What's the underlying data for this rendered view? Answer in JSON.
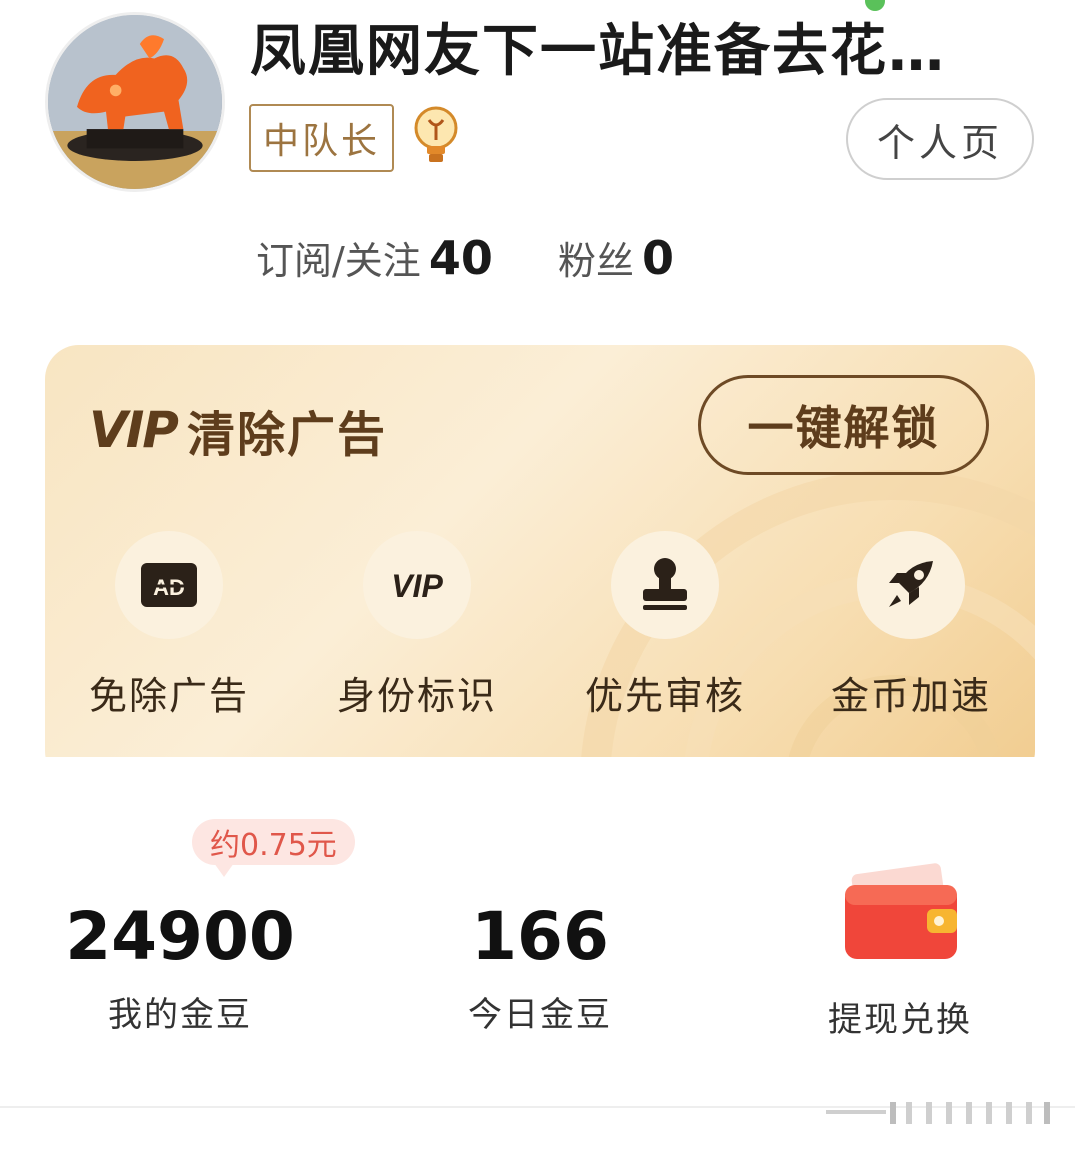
{
  "profile": {
    "username": "凤凰网友下一站准备去花…",
    "rank_badge": "中队长",
    "profile_button": "个人页",
    "following_label": "订阅/关注",
    "following_count": "40",
    "fans_label": "粉丝",
    "fans_count": "0"
  },
  "vip": {
    "logo": "VIP",
    "title": "清除广告",
    "unlock_button": "一键解锁",
    "perks": [
      {
        "label": "免除广告",
        "icon": "ad-block-icon"
      },
      {
        "label": "身份标识",
        "icon": "vip-badge-icon"
      },
      {
        "label": "优先审核",
        "icon": "stamp-icon"
      },
      {
        "label": "金币加速",
        "icon": "rocket-icon"
      }
    ]
  },
  "coins": {
    "price_tip": "约0.75元",
    "my_beans_value": "24900",
    "my_beans_label": "我的金豆",
    "today_beans_value": "166",
    "today_beans_label": "今日金豆",
    "withdraw_label": "提现兑换"
  },
  "colors": {
    "vip_brown": "#5e3d1c",
    "badge_gold": "#9c7440",
    "tip_red": "#e0574a",
    "wallet_red": "#f0463a"
  }
}
